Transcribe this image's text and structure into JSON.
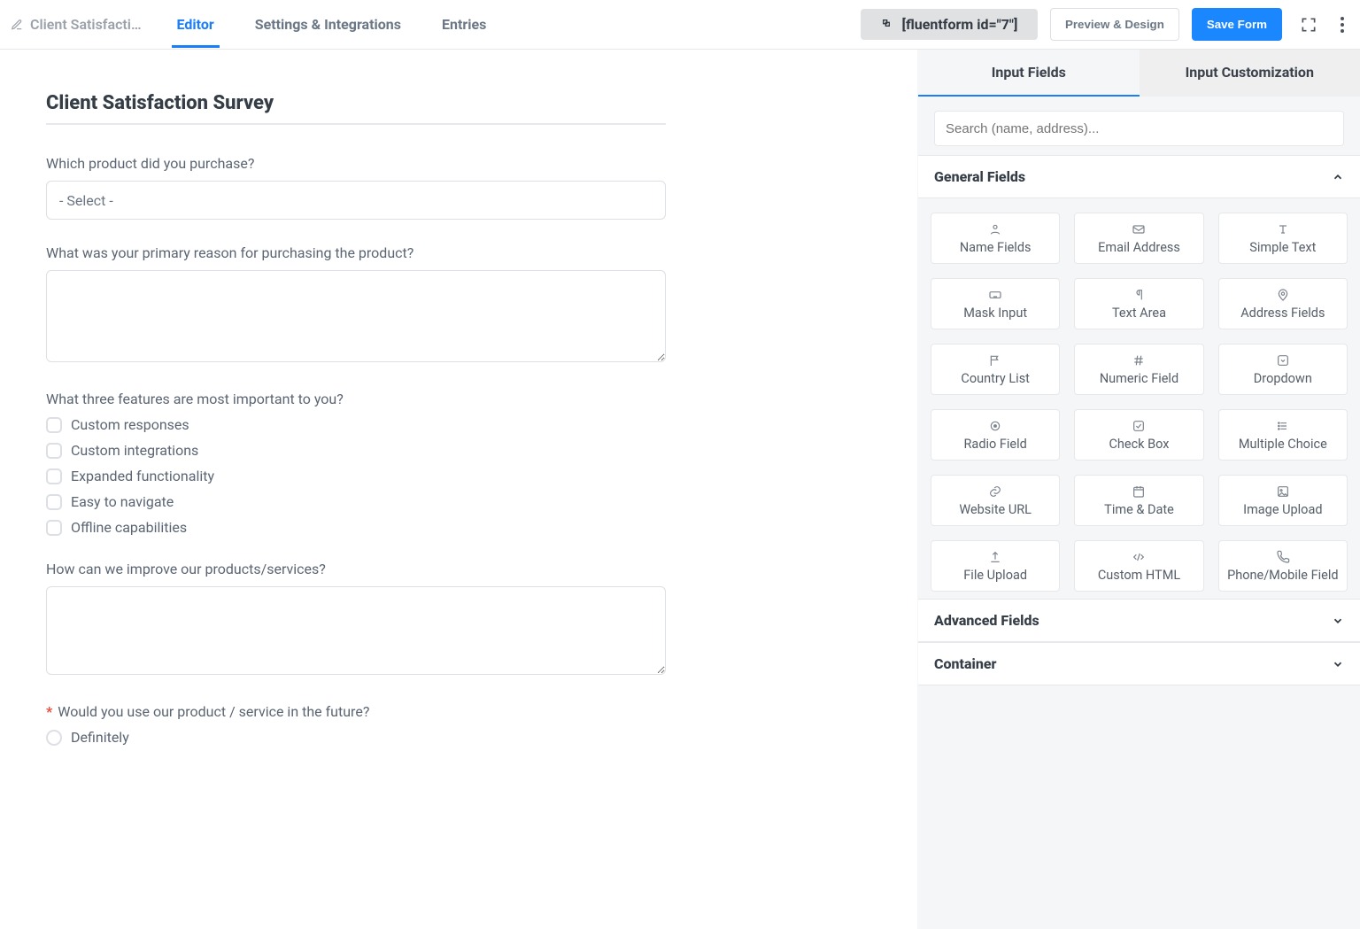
{
  "header": {
    "form_title": "Client Satisfacti…",
    "tabs": [
      {
        "label": "Editor",
        "active": true
      },
      {
        "label": "Settings & Integrations",
        "active": false
      },
      {
        "label": "Entries",
        "active": false
      }
    ],
    "shortcode": "[fluentform id=\"7\"]",
    "preview_label": "Preview & Design",
    "save_label": "Save Form"
  },
  "form": {
    "title": "Client Satisfaction Survey",
    "fields": [
      {
        "type": "select",
        "label": "Which product did you purchase?",
        "placeholder": "- Select -"
      },
      {
        "type": "textarea",
        "label": "What was your primary reason for purchasing the product?"
      },
      {
        "type": "checkbox",
        "label": "What three features are most important to you?",
        "options": [
          "Custom responses",
          "Custom integrations",
          "Expanded functionality",
          "Easy to navigate",
          "Offline capabilities"
        ]
      },
      {
        "type": "textarea",
        "label": "How can we improve our products/services?"
      },
      {
        "type": "radio",
        "required": true,
        "label": "Would you use our product / service in the future?",
        "options": [
          "Definitely"
        ]
      }
    ]
  },
  "panel": {
    "tabs": [
      "Input Fields",
      "Input Customization"
    ],
    "search_placeholder": "Search (name, address)...",
    "sections": [
      {
        "title": "General Fields",
        "open": true,
        "items": [
          {
            "icon": "user-icon",
            "label": "Name Fields"
          },
          {
            "icon": "mail-icon",
            "label": "Email Address"
          },
          {
            "icon": "text-icon",
            "label": "Simple Text"
          },
          {
            "icon": "keyboard-icon",
            "label": "Mask Input"
          },
          {
            "icon": "pilcrow-icon",
            "label": "Text Area"
          },
          {
            "icon": "map-pin-icon",
            "label": "Address Fields"
          },
          {
            "icon": "flag-icon",
            "label": "Country List"
          },
          {
            "icon": "hash-icon",
            "label": "Numeric Field"
          },
          {
            "icon": "caret-square-icon",
            "label": "Dropdown"
          },
          {
            "icon": "radio-icon",
            "label": "Radio Field"
          },
          {
            "icon": "check-icon",
            "label": "Check Box"
          },
          {
            "icon": "list-icon",
            "label": "Multiple Choice"
          },
          {
            "icon": "link-icon",
            "label": "Website URL"
          },
          {
            "icon": "calendar-icon",
            "label": "Time & Date"
          },
          {
            "icon": "image-icon",
            "label": "Image Upload"
          },
          {
            "icon": "upload-icon",
            "label": "File Upload"
          },
          {
            "icon": "code-icon",
            "label": "Custom HTML"
          },
          {
            "icon": "phone-icon",
            "label": "Phone/Mobile Field"
          }
        ]
      },
      {
        "title": "Advanced Fields",
        "open": false
      },
      {
        "title": "Container",
        "open": false
      }
    ]
  },
  "colors": {
    "accent": "#1a7efb",
    "primary_button": "#1b87ff"
  }
}
